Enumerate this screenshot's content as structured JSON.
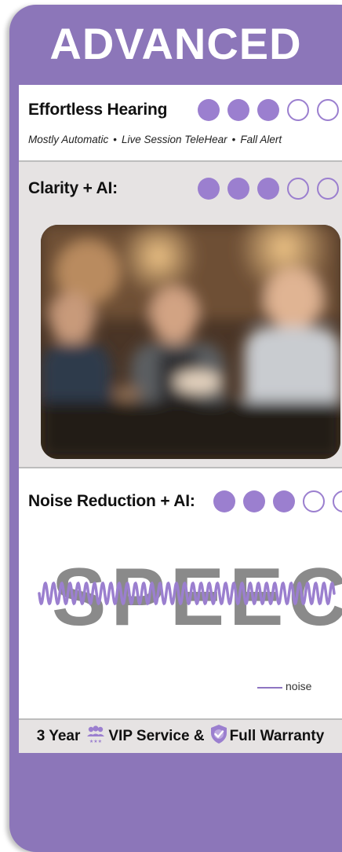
{
  "header": {
    "title": "ADVANCED"
  },
  "effortless": {
    "label": "Effortless Hearing",
    "rating": 3,
    "max": 5,
    "features": [
      "Mostly Automatic",
      "Live Session TeleHear",
      "Fall Alert"
    ],
    "separator": "•"
  },
  "clarity": {
    "label": "Clarity + AI:",
    "rating": 3,
    "max": 5
  },
  "noise": {
    "label": "Noise Reduction + AI:",
    "rating": 3,
    "max": 5,
    "speech_word": "SPEECH",
    "legend_label": "noise"
  },
  "warranty": {
    "part1": "3 Year",
    "part2": "VIP Service &",
    "part3": "Full Warranty",
    "icons": [
      "vip-people-icon",
      "shield-check-icon"
    ]
  },
  "colors": {
    "brand_purple": "#8c76b9",
    "dot_purple": "#9b7fcf",
    "section_gray": "#e6e3e3"
  }
}
